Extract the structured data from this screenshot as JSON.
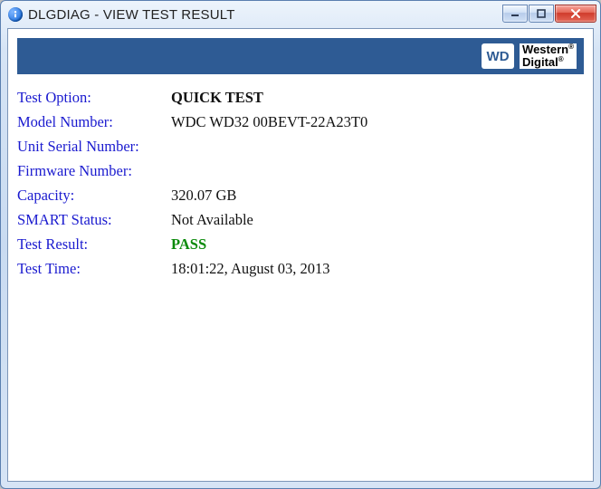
{
  "window": {
    "title": "DLGDIAG - VIEW TEST RESULT",
    "icon": "info-icon"
  },
  "brand": {
    "logo_box": "WD",
    "logo_line1": "Western",
    "logo_line2": "Digital"
  },
  "labels": {
    "test_option": "Test Option:",
    "model_number": "Model Number:",
    "unit_serial_number": "Unit Serial Number:",
    "firmware_number": "Firmware Number:",
    "capacity": "Capacity:",
    "smart_status": "SMART Status:",
    "test_result": "Test Result:",
    "test_time": "Test Time:"
  },
  "values": {
    "test_option": "QUICK TEST",
    "model_number": "WDC WD32 00BEVT-22A23T0",
    "unit_serial_number": "",
    "firmware_number": "",
    "capacity": "320.07 GB",
    "smart_status": "Not Available",
    "test_result": "PASS",
    "test_time": "18:01:22, August 03, 2013"
  }
}
